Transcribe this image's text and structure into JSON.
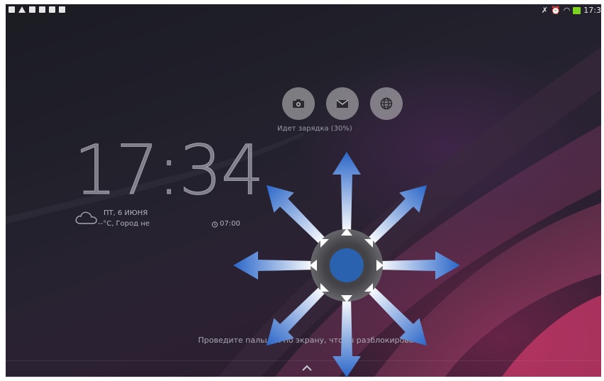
{
  "status_bar": {
    "time": "17:3",
    "left_icons": [
      "notification-icon",
      "warning-icon",
      "storage-icon",
      "file-icon",
      "check-icon",
      "media-icon"
    ],
    "right_icons": [
      "mute-icon",
      "alarm-icon",
      "wifi-icon",
      "battery-charging-icon"
    ]
  },
  "lockscreen": {
    "shortcuts": [
      "camera-icon",
      "mail-icon",
      "browser-globe-icon"
    ],
    "charging_text": "Идет зарядка (30%)",
    "clock": "17:34",
    "date": "ПТ, 6 ИЮНЯ",
    "weather": "--°C, Город не",
    "alarm_time": "07:00",
    "unlock_hint": "Проведите пальцем по экрану, чтобы разблокировать"
  },
  "overlay": {
    "type": "swipe-direction-indicator",
    "center_color": "#2b6cb8",
    "arrow_color": "#3a78d6",
    "ring_color": "#5a5a5a"
  }
}
